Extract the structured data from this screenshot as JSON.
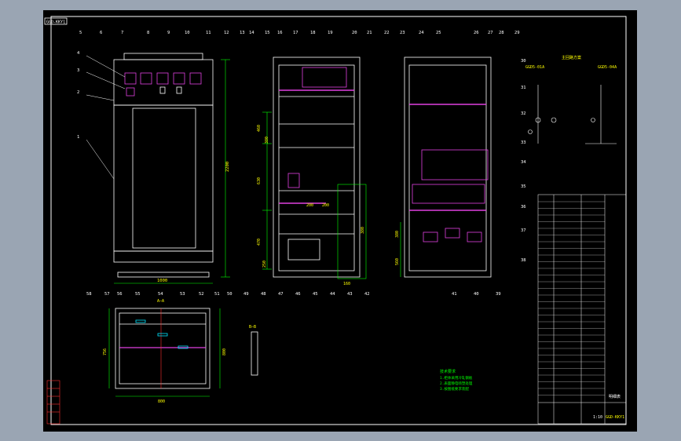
{
  "title_tag": "GGD-KKY1",
  "callouts_top": [
    "5",
    "6",
    "7",
    "8",
    "9",
    "10",
    "11",
    "12",
    "13",
    "14",
    "15",
    "16",
    "17",
    "18",
    "19",
    "20",
    "21",
    "22",
    "23",
    "24",
    "25",
    "26",
    "27",
    "28",
    "29"
  ],
  "callouts_left": [
    "4",
    "3",
    "2",
    "1"
  ],
  "callouts_right": [
    "30",
    "31",
    "32",
    "33",
    "34",
    "35",
    "36",
    "37",
    "38"
  ],
  "callouts_bottom_mid": [
    "49",
    "48",
    "47",
    "46",
    "45",
    "44",
    "43",
    "42"
  ],
  "callouts_bottom_right": [
    "41",
    "40",
    "39"
  ],
  "callouts_plan": [
    "58",
    "57",
    "56",
    "55",
    "54",
    "53",
    "52",
    "51",
    "50"
  ],
  "dims": {
    "front_height": "2200",
    "front_width": "1000",
    "side_top": "460",
    "side_a": "380",
    "side_b": "400",
    "side_c": "630",
    "side_d": "200",
    "side_e": "200",
    "side_f": "470",
    "side_g": "250",
    "side_h": "380",
    "side_i": "160",
    "rear_a": "380",
    "rear_b": "560",
    "plan_w": "800",
    "plan_h": "756",
    "plan_h2": "800",
    "plan_label": "A—A",
    "detail_label": "B—B",
    "rear_label": "GGD5-01A",
    "rear_label2": "GGD5-04A"
  },
  "schematic_title": "主回路方案",
  "notes_title": "技术要求",
  "notes_lines": [
    "1.柜体采用冷轧钢板",
    "2.表面静电喷塑处理",
    "3.按图纸要求装配"
  ],
  "bom_title": "明细表",
  "drawing_no": "GGD-KKY1",
  "scale": "1:10"
}
